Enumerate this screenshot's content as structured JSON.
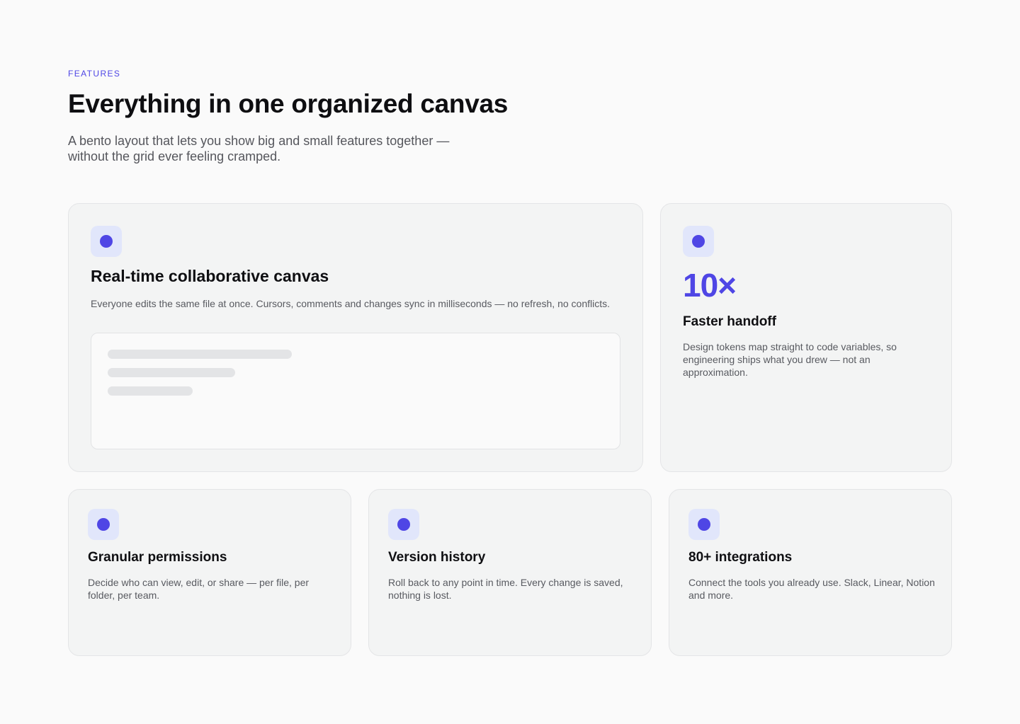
{
  "header": {
    "eyebrow": "FEATURES",
    "title": "Everything in one organized canvas",
    "subtitle": "A bento layout that lets you show big and small features together — without the grid ever feeling cramped."
  },
  "colors": {
    "accent": "#4f46e5",
    "icon_tile_bg": "#e1e6fb",
    "card_bg": "#f3f4f4",
    "page_bg": "#fafafa"
  },
  "cards": {
    "collab": {
      "icon": "dot-icon",
      "title": "Real-time collaborative canvas",
      "description": "Everyone edits the same file at once. Cursors, comments and changes sync in milliseconds — no refresh, no conflicts."
    },
    "handoff": {
      "icon": "dot-icon",
      "stat": "10×",
      "title": "Faster handoff",
      "description": "Design tokens map straight to code variables, so engineering ships what you drew — not an approximation."
    },
    "permissions": {
      "icon": "dot-icon",
      "title": "Granular permissions",
      "description": "Decide who can view, edit, or share — per file, per folder, per team."
    },
    "history": {
      "icon": "dot-icon",
      "title": "Version history",
      "description": "Roll back to any point in time. Every change is saved, nothing is lost."
    },
    "integrations": {
      "icon": "dot-icon",
      "title": "80+ integrations",
      "description": "Connect the tools you already use. Slack, Linear, Notion and more."
    }
  }
}
